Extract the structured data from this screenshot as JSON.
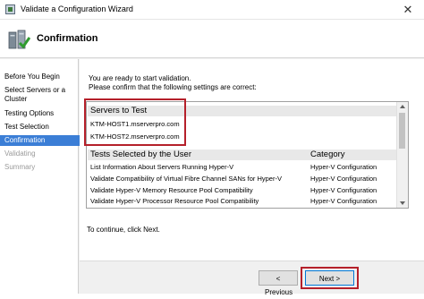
{
  "window": {
    "title": "Validate a Configuration Wizard",
    "close_glyph": "✕"
  },
  "header": {
    "title": "Confirmation",
    "icon": "cluster-wizard-icon"
  },
  "nav": {
    "items": [
      {
        "label": "Before You Begin",
        "state": "normal"
      },
      {
        "label": "Select Servers or a Cluster",
        "state": "normal"
      },
      {
        "label": "Testing Options",
        "state": "normal"
      },
      {
        "label": "Test Selection",
        "state": "normal"
      },
      {
        "label": "Confirmation",
        "state": "active"
      },
      {
        "label": "Validating",
        "state": "disabled"
      },
      {
        "label": "Summary",
        "state": "disabled"
      }
    ]
  },
  "main": {
    "intro_line1": "You are ready to start validation.",
    "intro_line2": "Please confirm that the following settings are correct:",
    "servers_header": "Servers to Test",
    "servers": [
      "KTM-HOST1.mserverpro.com",
      "KTM-HOST2.mserverpro.com"
    ],
    "tests_header": "Tests Selected by the User",
    "category_header": "Category",
    "tests": [
      {
        "name": "List Information About Servers Running Hyper-V",
        "category": "Hyper-V Configuration"
      },
      {
        "name": "Validate Compatibility of Virtual Fibre Channel SANs for Hyper-V",
        "category": "Hyper-V Configuration"
      },
      {
        "name": "Validate Hyper-V Memory Resource Pool Compatibility",
        "category": "Hyper-V Configuration"
      },
      {
        "name": "Validate Hyper-V Processor Resource Pool Compatibility",
        "category": "Hyper-V Configuration"
      }
    ],
    "continue_text": "To continue, click Next."
  },
  "buttons": {
    "previous": "< Previous",
    "next": "Next >"
  },
  "colors": {
    "highlight": "#b5202a",
    "nav_active": "#3b7ed6"
  }
}
